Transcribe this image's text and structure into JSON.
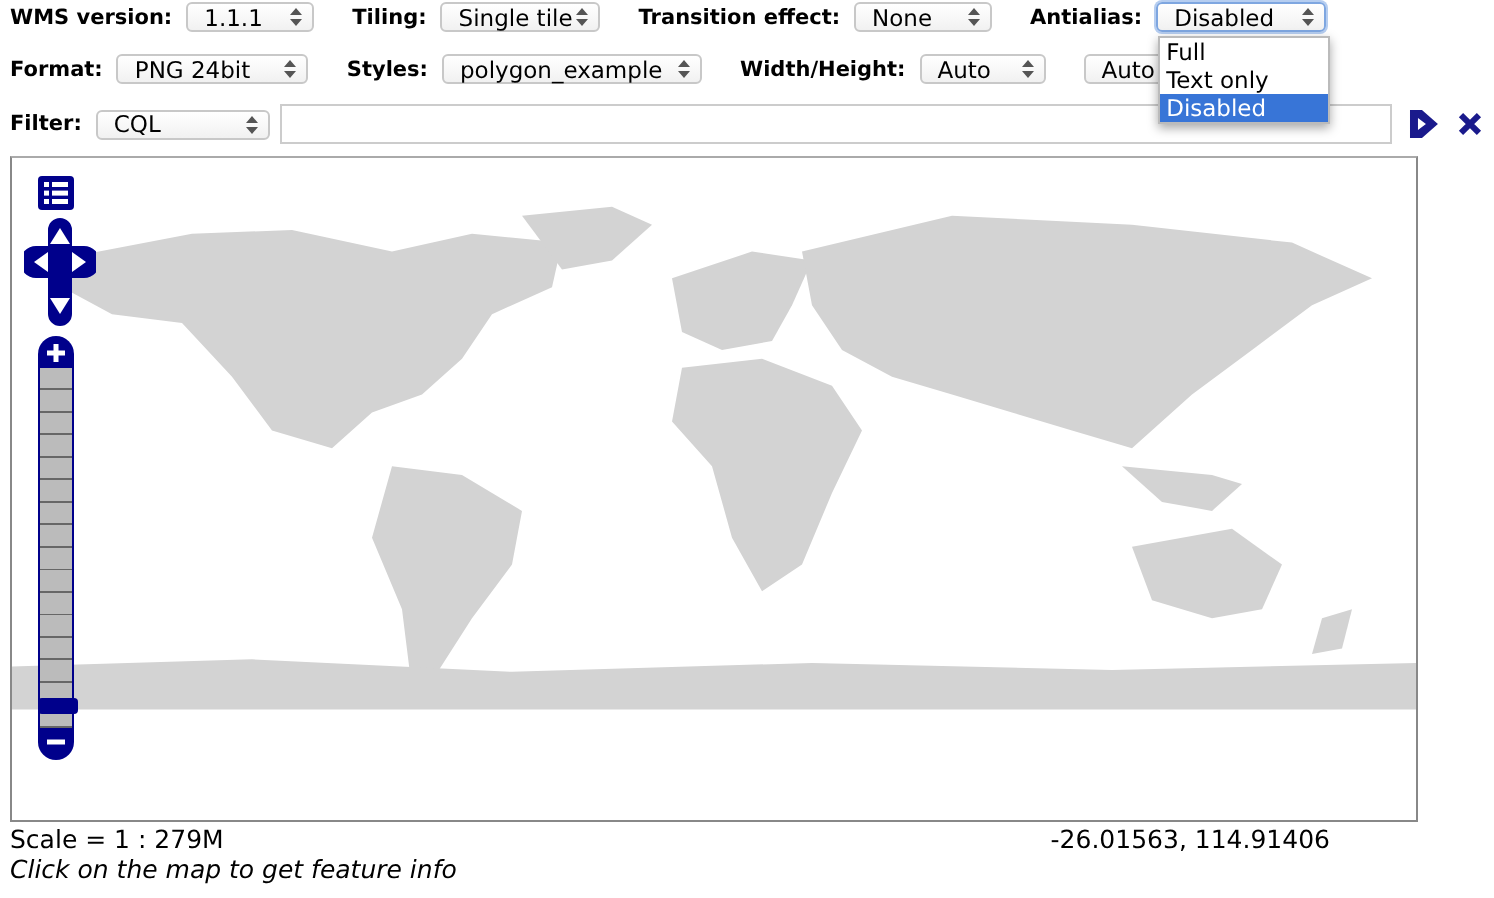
{
  "rows": [
    [
      {
        "label": "WMS version:",
        "selects": [
          {
            "value": "1.1.1",
            "expanded": false
          }
        ]
      },
      {
        "label": "Tiling:",
        "selects": [
          {
            "value": "Single tile",
            "expanded": false
          }
        ]
      },
      {
        "label": "Transition effect:",
        "selects": [
          {
            "value": "None",
            "expanded": false
          }
        ]
      },
      {
        "label": "Antialias:",
        "selects": [
          {
            "value": "Disabled",
            "expanded": true,
            "options": [
              {
                "label": "Full",
                "selected": false
              },
              {
                "label": "Text only",
                "selected": false
              },
              {
                "label": "Disabled",
                "selected": true
              }
            ]
          }
        ]
      }
    ],
    [
      {
        "label": "Format:",
        "selects": [
          {
            "value": "PNG 24bit",
            "expanded": false
          }
        ]
      },
      {
        "label": "Styles:",
        "selects": [
          {
            "value": "polygon_example",
            "expanded": false
          }
        ]
      },
      {
        "label": "Width/Height:",
        "selects": [
          {
            "value": "Auto",
            "expanded": false
          },
          {
            "value": "Auto",
            "expanded": false
          }
        ]
      }
    ]
  ],
  "filter": {
    "label": "Filter:",
    "type": "CQL"
  },
  "map": {
    "kind": "picture",
    "zoom": {
      "level": 0.04
    }
  },
  "scale": "Scale = 1 : 279M",
  "coordinates": "-26.01563, 114.91406",
  "hint": "Click on the map to get feature info"
}
